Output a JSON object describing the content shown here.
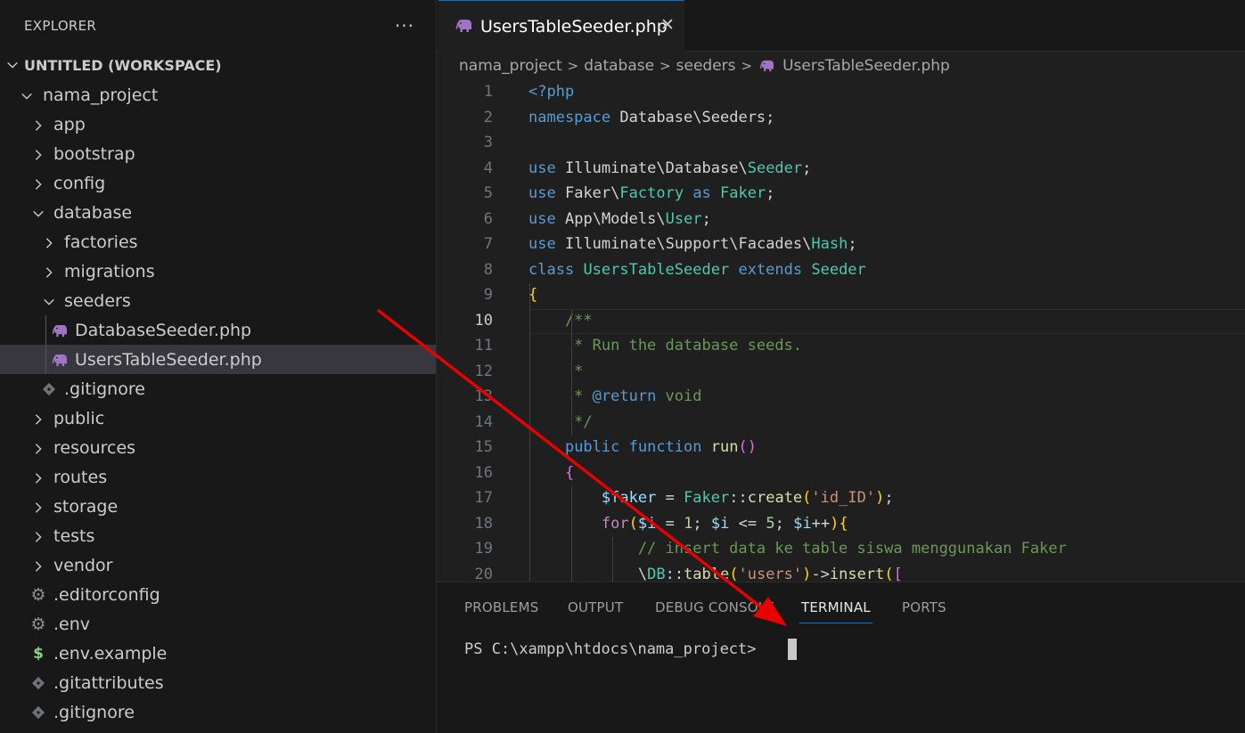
{
  "sidebar": {
    "title": "EXPLORER",
    "more": "···",
    "workspace": "UNTITLED (WORKSPACE)",
    "tree": [
      {
        "label": "nama_project",
        "kind": "folder-open",
        "depth": 0
      },
      {
        "label": "app",
        "kind": "folder",
        "depth": 1
      },
      {
        "label": "bootstrap",
        "kind": "folder",
        "depth": 1
      },
      {
        "label": "config",
        "kind": "folder",
        "depth": 1
      },
      {
        "label": "database",
        "kind": "folder-open",
        "depth": 1
      },
      {
        "label": "factories",
        "kind": "folder",
        "depth": 2
      },
      {
        "label": "migrations",
        "kind": "folder",
        "depth": 2
      },
      {
        "label": "seeders",
        "kind": "folder-open",
        "depth": 2
      },
      {
        "label": "DatabaseSeeder.php",
        "kind": "php-icon",
        "depth": 3
      },
      {
        "label": "UsersTableSeeder.php",
        "kind": "php-icon",
        "depth": 3,
        "selected": true
      },
      {
        "label": ".gitignore",
        "kind": "git-icon",
        "depth": 2
      },
      {
        "label": "public",
        "kind": "folder",
        "depth": 1
      },
      {
        "label": "resources",
        "kind": "folder",
        "depth": 1
      },
      {
        "label": "routes",
        "kind": "folder",
        "depth": 1
      },
      {
        "label": "storage",
        "kind": "folder",
        "depth": 1
      },
      {
        "label": "tests",
        "kind": "folder",
        "depth": 1
      },
      {
        "label": "vendor",
        "kind": "folder",
        "depth": 1
      },
      {
        "label": ".editorconfig",
        "kind": "gear-icon",
        "depth": 1
      },
      {
        "label": ".env",
        "kind": "gear-icon",
        "depth": 1
      },
      {
        "label": ".env.example",
        "kind": "dollar-icon",
        "depth": 1
      },
      {
        "label": ".gitattributes",
        "kind": "git-icon",
        "depth": 1
      },
      {
        "label": ".gitignore",
        "kind": "git-icon",
        "depth": 1
      }
    ]
  },
  "editor": {
    "tab_label": "UsersTableSeeder.php",
    "tab_close": "✕",
    "breadcrumb": [
      "nama_project",
      "database",
      "seeders",
      "UsersTableSeeder.php"
    ],
    "active_line": 10,
    "lines": [
      {
        "n": "1",
        "text": "<?php"
      },
      {
        "n": "2",
        "text": "namespace Database\\Seeders;"
      },
      {
        "n": "3",
        "text": ""
      },
      {
        "n": "4",
        "text": "use Illuminate\\Database\\Seeder;"
      },
      {
        "n": "5",
        "text": "use Faker\\Factory as Faker;"
      },
      {
        "n": "6",
        "text": "use App\\Models\\User;"
      },
      {
        "n": "7",
        "text": "use Illuminate\\Support\\Facades\\Hash;"
      },
      {
        "n": "8",
        "text": "class UsersTableSeeder extends Seeder"
      },
      {
        "n": "9",
        "text": "{"
      },
      {
        "n": "10",
        "text": "    /**"
      },
      {
        "n": "11",
        "text": "     * Run the database seeds."
      },
      {
        "n": "12",
        "text": "     *"
      },
      {
        "n": "13",
        "text": "     * @return void"
      },
      {
        "n": "14",
        "text": "     */"
      },
      {
        "n": "15",
        "text": "    public function run()"
      },
      {
        "n": "16",
        "text": "    {"
      },
      {
        "n": "17",
        "text": "        $faker = Faker::create('id_ID');"
      },
      {
        "n": "18",
        "text": "        for($i = 1; $i <= 5; $i++){"
      },
      {
        "n": "19",
        "text": "            // insert data ke table siswa menggunakan Faker"
      },
      {
        "n": "20",
        "text": "            \\DB::table('users')->insert(["
      }
    ]
  },
  "panel": {
    "tabs": [
      "PROBLEMS",
      "OUTPUT",
      "DEBUG CONSOLE",
      "TERMINAL",
      "PORTS"
    ],
    "active_tab": "TERMINAL",
    "terminal_prompt": "PS C:\\xampp\\htdocs\\nama_project> "
  },
  "colors": {
    "accent": "#0078d4",
    "arrow": "#e60000",
    "php_icon": "#a074c4"
  }
}
